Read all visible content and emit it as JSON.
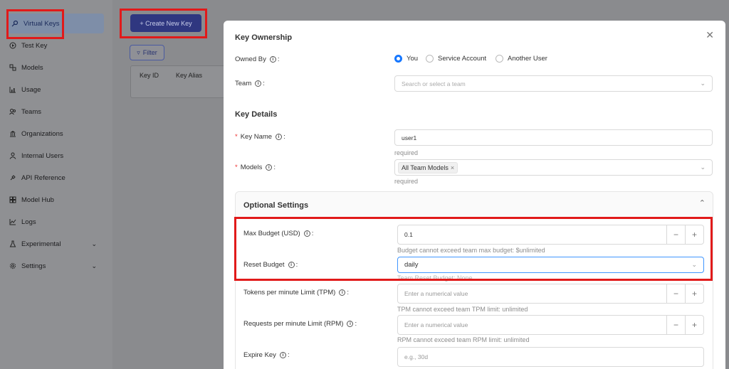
{
  "sidebar": {
    "items": [
      {
        "label": "Virtual Keys",
        "icon": "key-icon"
      },
      {
        "label": "Test Key",
        "icon": "play-circle-icon"
      },
      {
        "label": "Models",
        "icon": "models-icon"
      },
      {
        "label": "Usage",
        "icon": "bar-chart-icon"
      },
      {
        "label": "Teams",
        "icon": "team-icon"
      },
      {
        "label": "Organizations",
        "icon": "bank-icon"
      },
      {
        "label": "Internal Users",
        "icon": "user-icon"
      },
      {
        "label": "API Reference",
        "icon": "api-icon"
      },
      {
        "label": "Model Hub",
        "icon": "app-icon"
      },
      {
        "label": "Logs",
        "icon": "line-chart-icon"
      },
      {
        "label": "Experimental",
        "icon": "experiment-icon"
      },
      {
        "label": "Settings",
        "icon": "gear-icon"
      }
    ]
  },
  "main": {
    "create_label": "+ Create New Key",
    "filter_label": "Filter",
    "table_headers": [
      "Key ID",
      "Key Alias"
    ]
  },
  "modal": {
    "ownership_title": "Key Ownership",
    "owned_by_label": "Owned By",
    "owner_options": [
      "You",
      "Service Account",
      "Another User"
    ],
    "team_label": "Team",
    "team_placeholder": "Search or select a team",
    "details_title": "Key Details",
    "key_name_label": "Key Name",
    "key_name_value": "user1",
    "key_name_hint": "required",
    "models_label": "Models",
    "models_tag": "All Team Models",
    "models_hint": "required",
    "optional_title": "Optional Settings",
    "max_budget_label": "Max Budget (USD)",
    "max_budget_value": "0.1",
    "max_budget_hint": "Budget cannot exceed team max budget: $unlimited",
    "reset_budget_label": "Reset Budget",
    "reset_budget_value": "daily",
    "reset_budget_hint": "Team Reset Budget: None",
    "tpm_label": "Tokens per minute Limit (TPM)",
    "tpm_placeholder": "Enter a numerical value",
    "tpm_hint": "TPM cannot exceed team TPM limit: unlimited",
    "rpm_label": "Requests per minute Limit (RPM)",
    "rpm_placeholder": "Enter a numerical value",
    "rpm_hint": "RPM cannot exceed team RPM limit: unlimited",
    "expire_label": "Expire Key",
    "expire_placeholder": "e.g., 30d"
  },
  "colors": {
    "primary": "#1677ff",
    "highlight": "#e11a1a",
    "create_button": "#2f3780"
  }
}
